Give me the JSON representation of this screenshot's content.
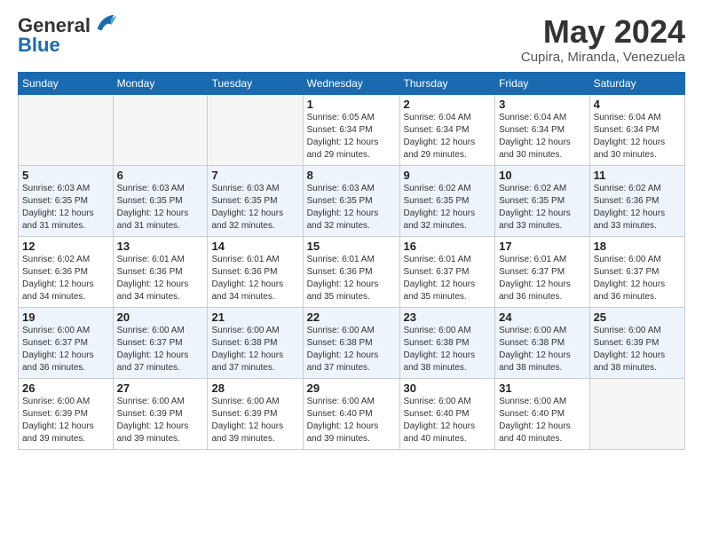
{
  "header": {
    "logo_line1": "General",
    "logo_line2": "Blue",
    "month": "May 2024",
    "location": "Cupira, Miranda, Venezuela"
  },
  "weekdays": [
    "Sunday",
    "Monday",
    "Tuesday",
    "Wednesday",
    "Thursday",
    "Friday",
    "Saturday"
  ],
  "weeks": [
    [
      {
        "day": "",
        "info": ""
      },
      {
        "day": "",
        "info": ""
      },
      {
        "day": "",
        "info": ""
      },
      {
        "day": "1",
        "info": "Sunrise: 6:05 AM\nSunset: 6:34 PM\nDaylight: 12 hours\nand 29 minutes."
      },
      {
        "day": "2",
        "info": "Sunrise: 6:04 AM\nSunset: 6:34 PM\nDaylight: 12 hours\nand 29 minutes."
      },
      {
        "day": "3",
        "info": "Sunrise: 6:04 AM\nSunset: 6:34 PM\nDaylight: 12 hours\nand 30 minutes."
      },
      {
        "day": "4",
        "info": "Sunrise: 6:04 AM\nSunset: 6:34 PM\nDaylight: 12 hours\nand 30 minutes."
      }
    ],
    [
      {
        "day": "5",
        "info": "Sunrise: 6:03 AM\nSunset: 6:35 PM\nDaylight: 12 hours\nand 31 minutes."
      },
      {
        "day": "6",
        "info": "Sunrise: 6:03 AM\nSunset: 6:35 PM\nDaylight: 12 hours\nand 31 minutes."
      },
      {
        "day": "7",
        "info": "Sunrise: 6:03 AM\nSunset: 6:35 PM\nDaylight: 12 hours\nand 32 minutes."
      },
      {
        "day": "8",
        "info": "Sunrise: 6:03 AM\nSunset: 6:35 PM\nDaylight: 12 hours\nand 32 minutes."
      },
      {
        "day": "9",
        "info": "Sunrise: 6:02 AM\nSunset: 6:35 PM\nDaylight: 12 hours\nand 32 minutes."
      },
      {
        "day": "10",
        "info": "Sunrise: 6:02 AM\nSunset: 6:35 PM\nDaylight: 12 hours\nand 33 minutes."
      },
      {
        "day": "11",
        "info": "Sunrise: 6:02 AM\nSunset: 6:36 PM\nDaylight: 12 hours\nand 33 minutes."
      }
    ],
    [
      {
        "day": "12",
        "info": "Sunrise: 6:02 AM\nSunset: 6:36 PM\nDaylight: 12 hours\nand 34 minutes."
      },
      {
        "day": "13",
        "info": "Sunrise: 6:01 AM\nSunset: 6:36 PM\nDaylight: 12 hours\nand 34 minutes."
      },
      {
        "day": "14",
        "info": "Sunrise: 6:01 AM\nSunset: 6:36 PM\nDaylight: 12 hours\nand 34 minutes."
      },
      {
        "day": "15",
        "info": "Sunrise: 6:01 AM\nSunset: 6:36 PM\nDaylight: 12 hours\nand 35 minutes."
      },
      {
        "day": "16",
        "info": "Sunrise: 6:01 AM\nSunset: 6:37 PM\nDaylight: 12 hours\nand 35 minutes."
      },
      {
        "day": "17",
        "info": "Sunrise: 6:01 AM\nSunset: 6:37 PM\nDaylight: 12 hours\nand 36 minutes."
      },
      {
        "day": "18",
        "info": "Sunrise: 6:00 AM\nSunset: 6:37 PM\nDaylight: 12 hours\nand 36 minutes."
      }
    ],
    [
      {
        "day": "19",
        "info": "Sunrise: 6:00 AM\nSunset: 6:37 PM\nDaylight: 12 hours\nand 36 minutes."
      },
      {
        "day": "20",
        "info": "Sunrise: 6:00 AM\nSunset: 6:37 PM\nDaylight: 12 hours\nand 37 minutes."
      },
      {
        "day": "21",
        "info": "Sunrise: 6:00 AM\nSunset: 6:38 PM\nDaylight: 12 hours\nand 37 minutes."
      },
      {
        "day": "22",
        "info": "Sunrise: 6:00 AM\nSunset: 6:38 PM\nDaylight: 12 hours\nand 37 minutes."
      },
      {
        "day": "23",
        "info": "Sunrise: 6:00 AM\nSunset: 6:38 PM\nDaylight: 12 hours\nand 38 minutes."
      },
      {
        "day": "24",
        "info": "Sunrise: 6:00 AM\nSunset: 6:38 PM\nDaylight: 12 hours\nand 38 minutes."
      },
      {
        "day": "25",
        "info": "Sunrise: 6:00 AM\nSunset: 6:39 PM\nDaylight: 12 hours\nand 38 minutes."
      }
    ],
    [
      {
        "day": "26",
        "info": "Sunrise: 6:00 AM\nSunset: 6:39 PM\nDaylight: 12 hours\nand 39 minutes."
      },
      {
        "day": "27",
        "info": "Sunrise: 6:00 AM\nSunset: 6:39 PM\nDaylight: 12 hours\nand 39 minutes."
      },
      {
        "day": "28",
        "info": "Sunrise: 6:00 AM\nSunset: 6:39 PM\nDaylight: 12 hours\nand 39 minutes."
      },
      {
        "day": "29",
        "info": "Sunrise: 6:00 AM\nSunset: 6:40 PM\nDaylight: 12 hours\nand 39 minutes."
      },
      {
        "day": "30",
        "info": "Sunrise: 6:00 AM\nSunset: 6:40 PM\nDaylight: 12 hours\nand 40 minutes."
      },
      {
        "day": "31",
        "info": "Sunrise: 6:00 AM\nSunset: 6:40 PM\nDaylight: 12 hours\nand 40 minutes."
      },
      {
        "day": "",
        "info": ""
      }
    ]
  ]
}
